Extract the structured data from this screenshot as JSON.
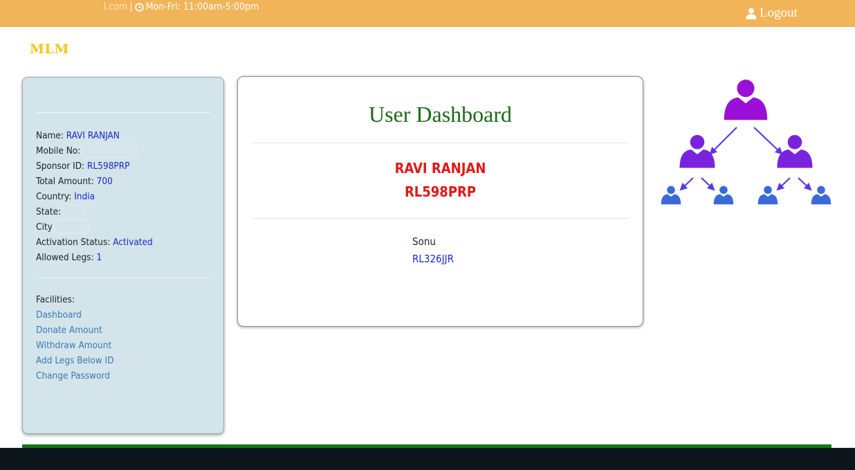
{
  "topbar": {
    "email_fragment": "l.com",
    "separator": "|",
    "hours": "Mon-Fri: 11:00am-5:00pm",
    "logout_label": "Logout",
    "background": "#f2b458",
    "icons": [
      "clock-icon",
      "user-icon"
    ]
  },
  "brand": {
    "name": "MLM",
    "color": "#f5c518"
  },
  "profile": {
    "name_label": "Name:",
    "name_value": "RAVI RANJAN",
    "mobile_label": "Mobile No:",
    "sponsor_label": "Sponsor ID:",
    "sponsor_value": "RL598PRP",
    "amount_label": "Total Amount:",
    "amount_value": "700",
    "country_label": "Country:",
    "country_value": "India",
    "state_label": "State:",
    "city_label": "City",
    "status_label": "Activation Status:",
    "status_value": "Activated",
    "legs_label": "Allowed Legs:",
    "legs_value": "1"
  },
  "facilities": {
    "heading": "Facilities:",
    "items": [
      {
        "label": "Dashboard"
      },
      {
        "label": "Donate Amount"
      },
      {
        "label": "Withdraw Amount"
      },
      {
        "label": "Add Legs Below ID"
      },
      {
        "label": "Change Password"
      }
    ]
  },
  "dashboard": {
    "title": "User Dashboard",
    "user_name": "RAVI RANJAN",
    "user_id": "RL598PRP",
    "leg_name": "Sonu",
    "leg_id": "RL326JJR"
  },
  "colors": {
    "sidebar_bg": "#d3e4ea",
    "title": "#1b6b14",
    "highlight": "#e01818",
    "value": "#1a28c8",
    "link": "#3a78b8",
    "tree_top": "#9a10d8",
    "tree_mid": "#7a22dc",
    "tree_leaf": "#3a6ad8",
    "footer_line": "#137a16",
    "footer": "#0c151a"
  }
}
